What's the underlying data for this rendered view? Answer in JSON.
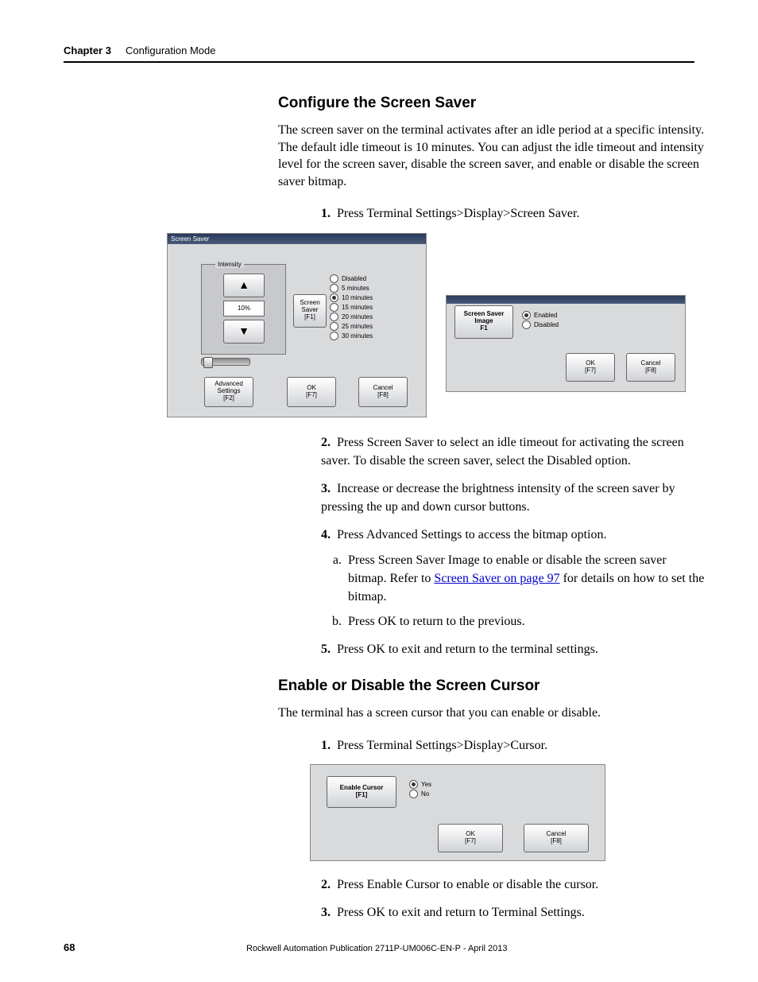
{
  "header": {
    "chapter_label": "Chapter 3",
    "chapter_title": "Configuration Mode"
  },
  "section1": {
    "heading": "Configure the Screen Saver",
    "intro": "The screen saver on the terminal activates after an idle period at a specific intensity. The default idle timeout is 10 minutes. You can adjust the idle timeout and intensity level for the screen saver, disable the screen saver, and enable or disable the screen saver bitmap.",
    "steps": [
      "Press Terminal Settings>Display>Screen Saver.",
      "Press Screen Saver to select an idle timeout for activating the screen saver. To disable the screen saver, select the Disabled option.",
      "Increase or decrease the brightness intensity of the screen saver by pressing the up and down cursor buttons.",
      "Press Advanced Settings to access the bitmap option.",
      "Press OK to exit and return to the terminal settings."
    ],
    "substeps4": {
      "a_pre": "Press Screen Saver Image to enable or disable the screen saver bitmap. Refer to ",
      "a_link": "Screen Saver on page 97",
      "a_post": " for details on how to set the bitmap.",
      "b": "Press OK to return to the previous."
    }
  },
  "fig1": {
    "titlebar": "Screen Saver",
    "intensity_label": "Intensity",
    "percent": "10%",
    "screensaver_btn_l1": "Screen",
    "screensaver_btn_l2": "Saver",
    "screensaver_btn_l3": "[F1]",
    "options": [
      "Disabled",
      "5 minutes",
      "10 minutes",
      "15 minutes",
      "20 minutes",
      "25 minutes",
      "30 minutes"
    ],
    "selected_index": 2,
    "adv_btn_l1": "Advanced",
    "adv_btn_l2": "Settings",
    "adv_btn_l3": "[F2]",
    "ok_btn_l1": "OK",
    "ok_btn_l2": "[F7]",
    "cancel_btn_l1": "Cancel",
    "cancel_btn_l2": "[F8]"
  },
  "fig2": {
    "img_btn_l1": "Screen Saver",
    "img_btn_l2": "Image",
    "img_btn_l3": "F1",
    "enabled": "Enabled",
    "disabled": "Disabled",
    "ok_l1": "OK",
    "ok_l2": "[F7]",
    "cancel_l1": "Cancel",
    "cancel_l2": "[F8]"
  },
  "section2": {
    "heading": "Enable or Disable the Screen Cursor",
    "intro": "The terminal has a screen cursor that you can enable or disable.",
    "steps": [
      "Press Terminal Settings>Display>Cursor.",
      "Press Enable Cursor to enable or disable the cursor.",
      "Press OK to exit and return to Terminal Settings."
    ]
  },
  "fig3": {
    "btn_l1": "Enable Cursor",
    "btn_l2": "[F1]",
    "yes": "Yes",
    "no": "No",
    "ok_l1": "OK",
    "ok_l2": "[F7]",
    "cancel_l1": "Cancel",
    "cancel_l2": "[F8]"
  },
  "footer": {
    "page": "68",
    "publication": "Rockwell Automation Publication 2711P-UM006C-EN-P - April 2013"
  }
}
